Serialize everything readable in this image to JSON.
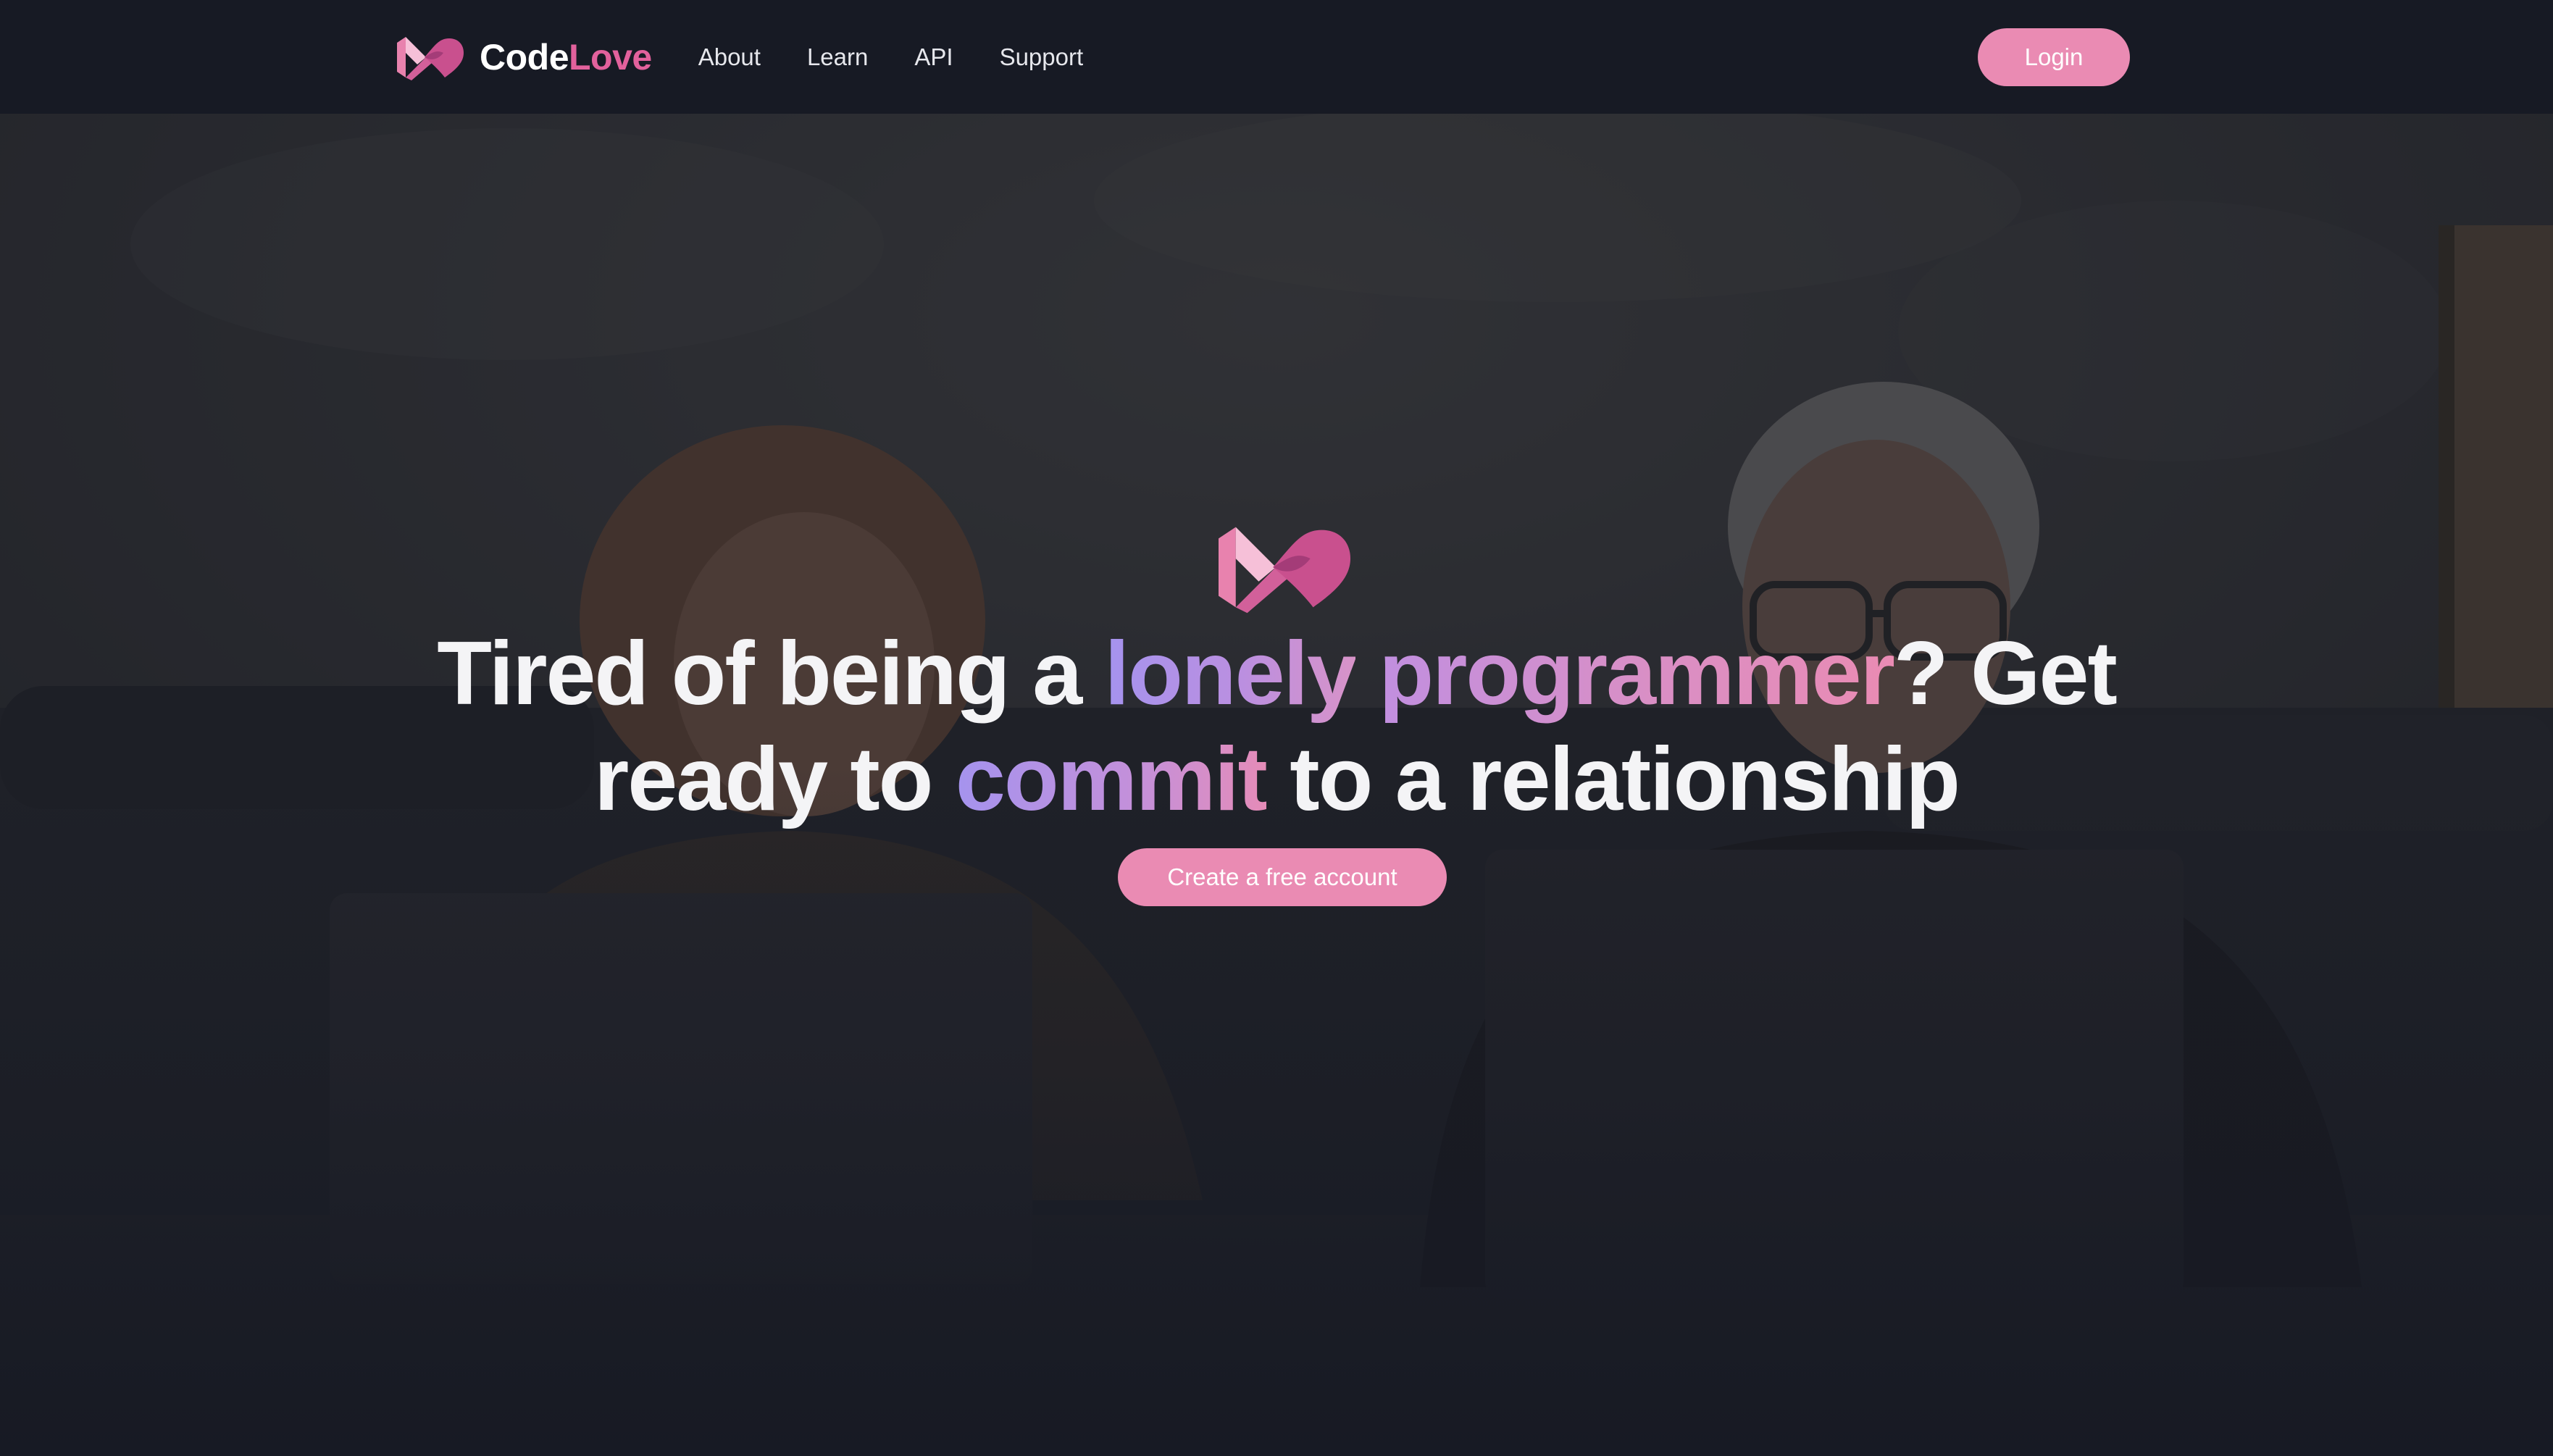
{
  "nav": {
    "brand_part1": "Code",
    "brand_part2": "Love",
    "links": [
      "About",
      "Learn",
      "API",
      "Support"
    ],
    "login_label": "Login"
  },
  "hero": {
    "headline": {
      "part1": "Tired of being a ",
      "highlight1": "lonely",
      "space": " ",
      "highlight2": "programmer",
      "part2": "? Get",
      "part3": "ready to ",
      "highlight3": "commit",
      "part4": " to a relationship"
    },
    "cta_label": "Create a free account"
  },
  "colors": {
    "background": "#171a24",
    "brand_pink": "#e2619c",
    "button_pink": "#ea8bb3",
    "gradient_purple": "#a593ee",
    "headline_text": "#f4f4f6"
  },
  "icons": {
    "brand_logo": "codelove-logo-icon",
    "hero_logo": "codelove-logo-icon"
  }
}
